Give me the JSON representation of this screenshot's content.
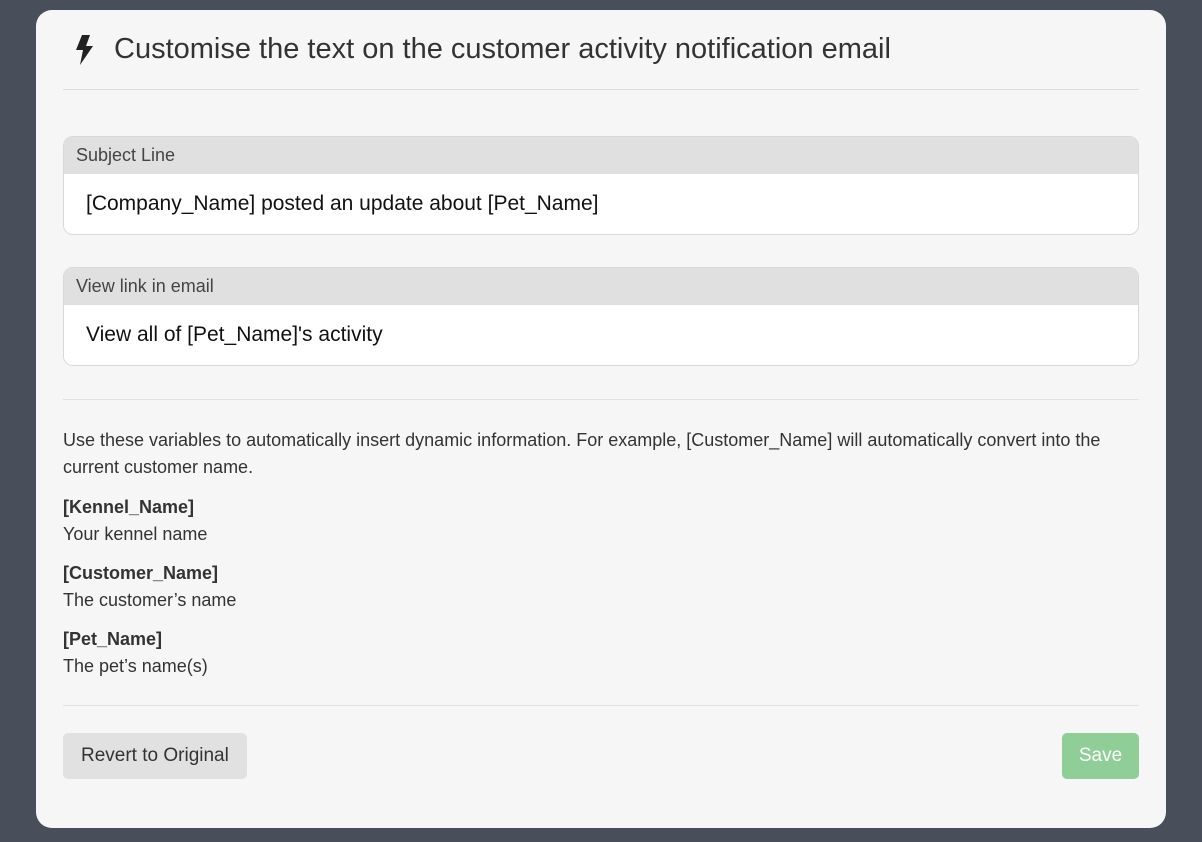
{
  "modal": {
    "title": "Customise the text on the customer activity notification email",
    "icon": "lightning-bolt-icon"
  },
  "fields": [
    {
      "label": "Subject Line",
      "value": "[Company_Name] posted an update about [Pet_Name]"
    },
    {
      "label": "View link in email",
      "value": "View all of [Pet_Name]'s activity"
    }
  ],
  "help_text": "Use these variables to automatically insert dynamic information. For example, [Customer_Name] will automatically convert into the current customer name.",
  "variables": [
    {
      "name": "[Kennel_Name]",
      "description": "Your kennel name"
    },
    {
      "name": "[Customer_Name]",
      "description": "The customer’s name"
    },
    {
      "name": "[Pet_Name]",
      "description": "The pet’s name(s)"
    }
  ],
  "buttons": {
    "revert_label": "Revert to Original",
    "save_label": "Save"
  },
  "colors": {
    "backdrop": "#484f5a",
    "modal_bg": "#f6f6f6",
    "save_button": "#8fcf97",
    "revert_button": "#e1e1e1"
  }
}
